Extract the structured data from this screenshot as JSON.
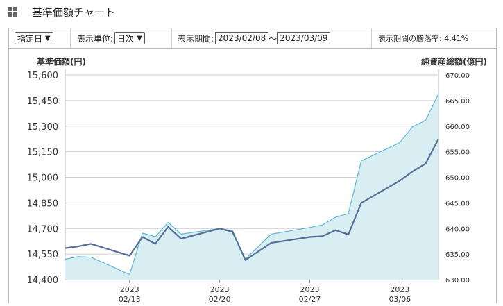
{
  "header": {
    "title": "基準価額チャート",
    "icon": "grid-icon"
  },
  "controls": {
    "date_mode": "指定日",
    "unit_label": "表示単位:",
    "unit_value": "日次",
    "period_label": "表示期間:",
    "start_date": "2023/02/08",
    "tilde": "～",
    "end_date": "2023/03/09",
    "change_label": "表示期間の騰落率: 4.41%"
  },
  "chart_data": {
    "type": "line",
    "left_axis_label": "基準価額(円)",
    "right_axis_label": "純資産総額(億円)",
    "left_ylim": [
      14400,
      15600
    ],
    "right_ylim": [
      630,
      670
    ],
    "left_ticks": [
      "15,600",
      "15,450",
      "15,300",
      "15,150",
      "15,000",
      "14,850",
      "14,700",
      "14,550",
      "14,400"
    ],
    "right_ticks": [
      "670.00",
      "665.00",
      "660.00",
      "655.00",
      "650.00",
      "645.00",
      "640.00",
      "635.00",
      "630.00"
    ],
    "x_tick_labels": [
      {
        "year": "2023",
        "date": "02/13"
      },
      {
        "year": "2023",
        "date": "02/20"
      },
      {
        "year": "2023",
        "date": "02/27"
      },
      {
        "year": "2023",
        "date": "03/06"
      }
    ],
    "x_tick_dates": [
      "2023-02-13",
      "2023-02-20",
      "2023-02-27",
      "2023-03-06"
    ],
    "x": [
      "2023-02-08",
      "2023-02-09",
      "2023-02-10",
      "2023-02-13",
      "2023-02-14",
      "2023-02-15",
      "2023-02-16",
      "2023-02-17",
      "2023-02-20",
      "2023-02-21",
      "2023-02-22",
      "2023-02-24",
      "2023-02-27",
      "2023-02-28",
      "2023-03-01",
      "2023-03-02",
      "2023-03-03",
      "2023-03-06",
      "2023-03-07",
      "2023-03-08",
      "2023-03-09"
    ],
    "series": [
      {
        "name": "基準価額",
        "axis": "left",
        "color": "#546f95",
        "values": [
          14585,
          14595,
          14610,
          14540,
          14650,
          14610,
          14710,
          14640,
          14700,
          14680,
          14515,
          14615,
          14650,
          14655,
          14690,
          14665,
          14850,
          14980,
          15035,
          15080,
          15225
        ]
      },
      {
        "name": "純資産総額",
        "axis": "right",
        "color": "#5bb8d0",
        "fill": "#d9eef3",
        "values": [
          634.0,
          634.5,
          634.4,
          631.0,
          639.1,
          638.4,
          641.2,
          638.9,
          640.0,
          639.6,
          634.0,
          638.9,
          640.2,
          640.7,
          642.2,
          642.9,
          653.2,
          656.8,
          659.9,
          661.1,
          666.3
        ]
      }
    ],
    "grid": true
  }
}
